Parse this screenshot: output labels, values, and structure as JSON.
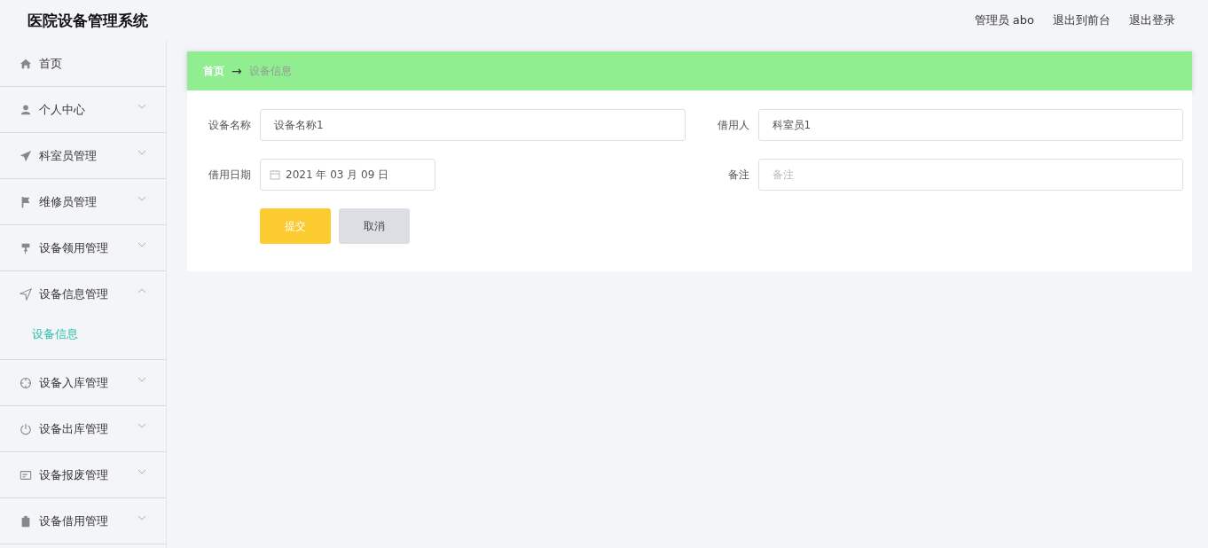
{
  "header": {
    "title": "医院设备管理系统",
    "links": [
      "管理员 abo",
      "退出到前台",
      "退出登录"
    ]
  },
  "sidebar": {
    "items": [
      {
        "label": "首页",
        "kind": "link"
      },
      {
        "label": "个人中心",
        "kind": "group",
        "expanded": false
      },
      {
        "label": "科室员管理",
        "kind": "group",
        "expanded": false
      },
      {
        "label": "维修员管理",
        "kind": "group",
        "expanded": false
      },
      {
        "label": "设备领用管理",
        "kind": "group",
        "expanded": false
      },
      {
        "label": "设备信息管理",
        "kind": "group",
        "expanded": true,
        "children": [
          {
            "label": "设备信息",
            "selected": true
          }
        ]
      },
      {
        "label": "设备入库管理",
        "kind": "group",
        "expanded": false
      },
      {
        "label": "设备出库管理",
        "kind": "group",
        "expanded": false
      },
      {
        "label": "设备报废管理",
        "kind": "group",
        "expanded": false
      },
      {
        "label": "设备借用管理",
        "kind": "group",
        "expanded": false
      }
    ]
  },
  "breadcrumb": {
    "home": "首页",
    "arrow": "→",
    "current": "设备信息"
  },
  "form": {
    "rows": [
      [
        {
          "label": "设备名称",
          "kind": "text",
          "value": "设备名称1"
        },
        {
          "label": "借用人",
          "kind": "text",
          "value": "科室员1"
        }
      ],
      [
        {
          "label": "借用日期",
          "kind": "date",
          "value": "2021 年 03 月 09 日"
        },
        {
          "label": "备注",
          "kind": "text",
          "placeholder": "备注"
        }
      ]
    ],
    "buttons": [
      {
        "label": "提交",
        "kind": "primary"
      },
      {
        "label": "取消",
        "kind": "secondary"
      }
    ]
  }
}
